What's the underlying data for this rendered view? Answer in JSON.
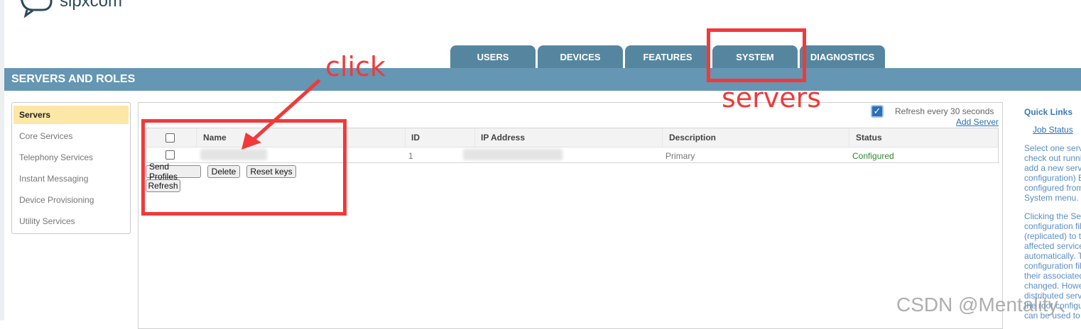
{
  "logo": {
    "text": "sipxcom"
  },
  "tabs": [
    {
      "label": "USERS"
    },
    {
      "label": "DEVICES"
    },
    {
      "label": "FEATURES"
    },
    {
      "label": "SYSTEM"
    },
    {
      "label": "DIAGNOSTICS"
    }
  ],
  "page_title": "SERVERS AND ROLES",
  "sidebar": {
    "items": [
      {
        "label": "Servers",
        "active": true
      },
      {
        "label": "Core Services"
      },
      {
        "label": "Telephony Services"
      },
      {
        "label": "Instant Messaging"
      },
      {
        "label": "Device Provisioning"
      },
      {
        "label": "Utility Services"
      }
    ]
  },
  "refresh": {
    "checked": true,
    "label": "Refresh every  30  seconds"
  },
  "add_server": "Add Server",
  "table": {
    "columns": [
      "Name",
      "ID",
      "IP Address",
      "Description",
      "Status"
    ],
    "rows": [
      {
        "name": "",
        "id": "1",
        "ip": "",
        "description": "Primary",
        "status": "Configured"
      }
    ]
  },
  "buttons": {
    "send_profiles": "Send Profiles",
    "delete": "Delete",
    "reset_keys": "Reset keys",
    "refresh": "Refresh"
  },
  "quick_links": {
    "title": "Quick Links",
    "job_status": "Job Status",
    "para1": [
      "Select one serv",
      "check out runni",
      "add a new serv",
      "configuration) E",
      "configured from",
      "System menu."
    ],
    "para2": [
      "Clicking the Se",
      "configuration fil",
      "(replicated) to t",
      "affected service",
      "automatically. T",
      "configuration fil",
      "their associated",
      "changed. Howe",
      "distributed serv",
      "the root configu",
      "can be used to"
    ]
  },
  "annotations": {
    "click": "click",
    "servers": "servers"
  },
  "watermark": "CSDN @Mentality、",
  "colors": {
    "tab": "#56869f",
    "band": "#6596b3",
    "annotation": "#f03a3a",
    "status_ok": "#2e8b2e"
  }
}
